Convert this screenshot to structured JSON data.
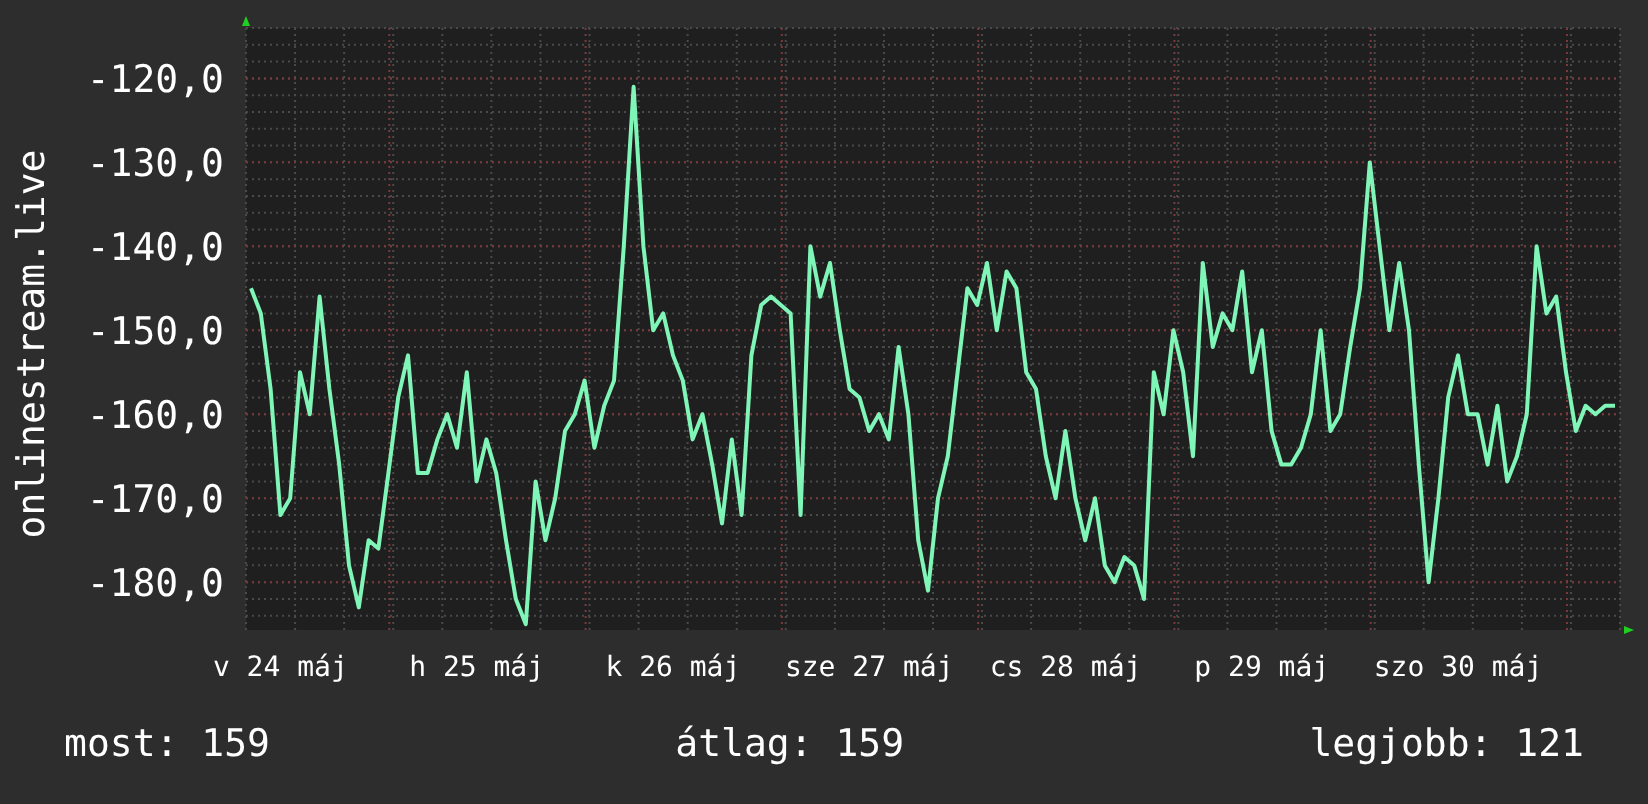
{
  "chart": {
    "chart_data": {
      "type": "line",
      "ylabel": "onlinestream.live",
      "grid": true,
      "ylim": [
        -185.7,
        -114
      ],
      "yticks": [
        {
          "value": -180,
          "label": "-180,0"
        },
        {
          "value": -170,
          "label": "-170,0"
        },
        {
          "value": -160,
          "label": "-160,0"
        },
        {
          "value": -150,
          "label": "-150,0"
        },
        {
          "value": -140,
          "label": "-140,0"
        },
        {
          "value": -130,
          "label": "-130,0"
        },
        {
          "value": -120,
          "label": "-120,0"
        }
      ],
      "categories": [
        null,
        null,
        null,
        "v 24 máj",
        null,
        null,
        null,
        null,
        null,
        null,
        null,
        null,
        null,
        null,
        null,
        null,
        null,
        null,
        null,
        null,
        null,
        null,
        null,
        "h 25 máj",
        null,
        null,
        null,
        null,
        null,
        null,
        null,
        null,
        null,
        null,
        null,
        null,
        null,
        null,
        null,
        null,
        null,
        null,
        null,
        "k 26 máj",
        null,
        null,
        null,
        null,
        null,
        null,
        null,
        null,
        null,
        null,
        null,
        null,
        null,
        null,
        null,
        null,
        null,
        null,
        null,
        "sze 27 máj",
        null,
        null,
        null,
        null,
        null,
        null,
        null,
        null,
        null,
        null,
        null,
        null,
        null,
        null,
        null,
        null,
        null,
        null,
        null,
        "cs 28 máj",
        null,
        null,
        null,
        null,
        null,
        null,
        null,
        null,
        null,
        null,
        null,
        null,
        null,
        null,
        null,
        null,
        null,
        null,
        null,
        "p 29 máj",
        null,
        null,
        null,
        null,
        null,
        null,
        null,
        null,
        null,
        null,
        null,
        null,
        null,
        null,
        null,
        null,
        null,
        null,
        null,
        "szo 30 máj",
        null,
        null,
        null,
        null,
        null,
        null,
        null,
        null,
        null,
        null,
        null,
        null,
        null,
        null,
        null,
        null
      ],
      "series": [
        {
          "color": "#7ff5b8",
          "values": [
            -145,
            -148,
            -157,
            -172,
            -170,
            -155,
            -160,
            -146,
            -157,
            -166,
            -178,
            -183,
            -175,
            -176,
            -167,
            -158,
            -153,
            -167,
            -167,
            -163,
            -160,
            -164,
            -155,
            -168,
            -163,
            -167,
            -175,
            -182,
            -185,
            -168,
            -175,
            -170,
            -162,
            -160,
            -156,
            -164,
            -159,
            -156,
            -140,
            -121,
            -140,
            -150,
            -148,
            -153,
            -156,
            -163,
            -160,
            -166,
            -173,
            -163,
            -172,
            -153,
            -147,
            -146,
            -147,
            -148,
            -172,
            -140,
            -146,
            -142,
            -150,
            -157,
            -158,
            -162,
            -160,
            -163,
            -152,
            -160,
            -175,
            -181,
            -170,
            -165,
            -155,
            -145,
            -147,
            -142,
            -150,
            -143,
            -145,
            -155,
            -157,
            -165,
            -170,
            -162,
            -170,
            -175,
            -170,
            -178,
            -180,
            -177,
            -178,
            -182,
            -155,
            -160,
            -150,
            -155,
            -165,
            -142,
            -152,
            -148,
            -150,
            -143,
            -155,
            -150,
            -162,
            -166,
            -166,
            -164,
            -160,
            -150,
            -162,
            -160,
            -152,
            -145,
            -130,
            -140,
            -150,
            -142,
            -150,
            -166,
            -180,
            -170,
            -158,
            -153,
            -160,
            -160,
            -166,
            -159,
            -168,
            -165,
            -160,
            -140,
            -148,
            -146,
            -155,
            -162,
            -159,
            -160,
            -159,
            -159
          ]
        }
      ]
    }
  },
  "legend": [
    {
      "label": "most: 159"
    },
    {
      "label": "átlag: 159"
    },
    {
      "label": "legjobb: 121"
    }
  ]
}
